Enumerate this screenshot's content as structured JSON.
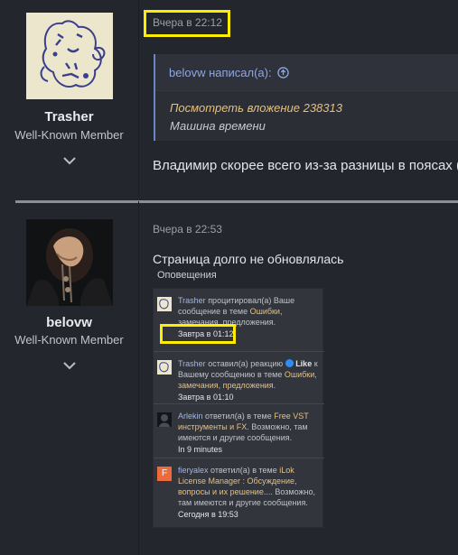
{
  "post1": {
    "username": "Trasher",
    "user_title": "Well-Known Member",
    "time": "Вчера в 22:12",
    "quote": {
      "author_line": "belovw написал(а):",
      "attachment_link": "Посмотреть вложение 238313",
      "note": "Машина времени"
    },
    "message": "Владимир скорее всего из-за разницы в поясах ("
  },
  "post2": {
    "username": "belovw",
    "user_title": "Well-Known Member",
    "time": "Вчера в 22:53",
    "message": "Страница долго не обновлялась",
    "notifications_title": "Оповещения",
    "notifications": [
      {
        "user": "Trasher",
        "text": " процитировал(а) Ваше сообщение в теме ",
        "strong": "Ошибки,",
        "rest": " замечания, предложения.",
        "time": "Завтра в 01:12"
      },
      {
        "user": "Trasher",
        "text": " оставил(а) реакцию ",
        "reaction": "Like",
        "text2": " к Вашему сообщению в теме ",
        "strong": "Ошибки, замечания, предложения.",
        "time": "Завтра в 01:10"
      },
      {
        "user": "Arlekin",
        "text": " ответил(а) в теме ",
        "strong": "Free VST инструменты и FX.",
        "rest": " Возможно, там имеются и другие сообщения.",
        "time": "In 9 minutes"
      },
      {
        "user": "fieryalex",
        "text": " ответил(а) в теме ",
        "strong": "iLok License Manager : Обсуждение, вопросы и их решение....",
        "rest": " Возможно, там имеются и другие сообщения.",
        "time": "Сегодня в 19:53"
      }
    ]
  },
  "avatar_letter": "F",
  "colors": {
    "background": "#23262d",
    "highlight": "#ffee00",
    "link": "#e7c07a",
    "quote_author": "#8ea8e0"
  }
}
